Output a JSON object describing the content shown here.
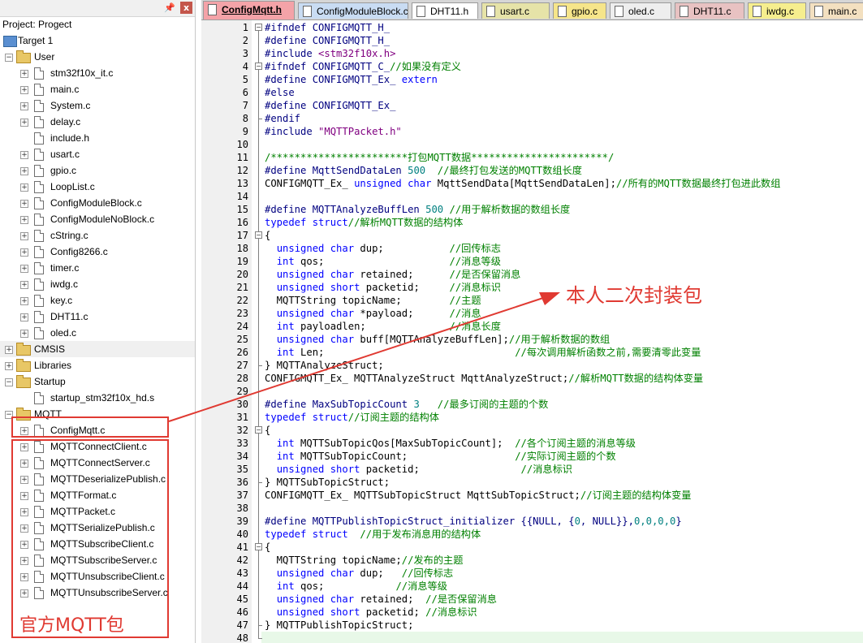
{
  "project_pane": {
    "title": "Project: Progect",
    "pin_icon": "pin-icon",
    "close_label": "x",
    "target": "Target 1",
    "groups": [
      {
        "name": "User",
        "files": [
          "stm32f10x_it.c",
          "main.c",
          "System.c",
          "delay.c",
          "include.h",
          "usart.c",
          "gpio.c",
          "LoopList.c",
          "ConfigModuleBlock.c",
          "ConfigModuleNoBlock.c",
          "cString.c",
          "Config8266.c",
          "timer.c",
          "iwdg.c",
          "key.c",
          "DHT11.c",
          "oled.c"
        ]
      },
      {
        "name": "CMSIS",
        "files": []
      },
      {
        "name": "Libraries",
        "files": []
      },
      {
        "name": "Startup",
        "files": [
          "startup_stm32f10x_hd.s"
        ]
      },
      {
        "name": "MQTT",
        "files": [
          "ConfigMqtt.c",
          "MQTTConnectClient.c",
          "MQTTConnectServer.c",
          "MQTTDeserializePublish.c",
          "MQTTFormat.c",
          "MQTTPacket.c",
          "MQTTSerializePublish.c",
          "MQTTSubscribeClient.c",
          "MQTTSubscribeServer.c",
          "MQTTUnsubscribeClient.c",
          "MQTTUnsubscribeServer.c"
        ]
      }
    ]
  },
  "tabs": [
    {
      "label": "ConfigMqtt.h",
      "active": true,
      "color": "#f4a3a8"
    },
    {
      "label": "ConfigModuleBlock.c",
      "color": "#c9dcf3"
    },
    {
      "label": "DHT11.h",
      "color": "#ffffff"
    },
    {
      "label": "usart.c",
      "color": "#e6e3a8"
    },
    {
      "label": "gpio.c",
      "color": "#f6e58a"
    },
    {
      "label": "oled.c",
      "color": "#eeeeee"
    },
    {
      "label": "DHT11.c",
      "color": "#e8c2c2"
    },
    {
      "label": "iwdg.c",
      "color": "#f6ee8e"
    },
    {
      "label": "main.c",
      "color": "#f3e0c0"
    }
  ],
  "editor": {
    "line_numbers": [
      "1",
      "2",
      "3",
      "4",
      "5",
      "6",
      "7",
      "8",
      "9",
      "10",
      "11",
      "12",
      "13",
      "14",
      "15",
      "16",
      "17",
      "18",
      "19",
      "20",
      "21",
      "22",
      "23",
      "24",
      "25",
      "26",
      "27",
      "28",
      "29",
      "30",
      "31",
      "32",
      "33",
      "34",
      "35",
      "36",
      "37",
      "38",
      "39",
      "40",
      "41",
      "42",
      "43",
      "44",
      "45",
      "46",
      "47",
      "48"
    ],
    "lines": [
      [
        [
          "pp",
          "#ifndef CONFIGMQTT_H_"
        ]
      ],
      [
        [
          "pp",
          "#define CONFIGMQTT_H_"
        ]
      ],
      [
        [
          "pp",
          "#include "
        ],
        [
          "str",
          "<stm32f10x.h>"
        ]
      ],
      [
        [
          "pp",
          "#ifndef CONFIGMQTT_C_"
        ],
        [
          "cm",
          "//如果没有定义"
        ]
      ],
      [
        [
          "pp",
          "#define CONFIGMQTT_Ex_ "
        ],
        [
          "kw",
          "extern"
        ]
      ],
      [
        [
          "pp",
          "#else"
        ]
      ],
      [
        [
          "pp",
          "#define CONFIGMQTT_Ex_"
        ]
      ],
      [
        [
          "pp",
          "#endif"
        ]
      ],
      [
        [
          "pp",
          "#include "
        ],
        [
          "str",
          "\"MQTTPacket.h\""
        ]
      ],
      [],
      [
        [
          "cm",
          "/***********************打包MQTT数据***********************/"
        ]
      ],
      [
        [
          "pp",
          "#define MqttSendDataLen "
        ],
        [
          "num",
          "500"
        ],
        [
          "cm",
          "  //最终打包发送的MQTT数组长度"
        ]
      ],
      [
        [
          "tx",
          "CONFIGMQTT_Ex_ "
        ],
        [
          "kw",
          "unsigned char"
        ],
        [
          "tx",
          " MqttSendData[MqttSendDataLen];"
        ],
        [
          "cm",
          "//所有的MQTT数据最终打包进此数组"
        ]
      ],
      [],
      [
        [
          "pp",
          "#define MQTTAnalyzeBuffLen "
        ],
        [
          "num",
          "500"
        ],
        [
          "cm",
          " //用于解析数据的数组长度"
        ]
      ],
      [
        [
          "kw",
          "typedef struct"
        ],
        [
          "cm",
          "//解析MQTT数据的结构体"
        ]
      ],
      [
        [
          "tx",
          "{"
        ]
      ],
      [
        [
          "tx",
          "  "
        ],
        [
          "kw",
          "unsigned char"
        ],
        [
          "tx",
          " dup;           "
        ],
        [
          "cm",
          "//回传标志"
        ]
      ],
      [
        [
          "tx",
          "  "
        ],
        [
          "kw",
          "int"
        ],
        [
          "tx",
          " qos;                     "
        ],
        [
          "cm",
          "//消息等级"
        ]
      ],
      [
        [
          "tx",
          "  "
        ],
        [
          "kw",
          "unsigned char"
        ],
        [
          "tx",
          " retained;      "
        ],
        [
          "cm",
          "//是否保留消息"
        ]
      ],
      [
        [
          "tx",
          "  "
        ],
        [
          "kw",
          "unsigned short"
        ],
        [
          "tx",
          " packetid;     "
        ],
        [
          "cm",
          "//消息标识"
        ]
      ],
      [
        [
          "tx",
          "  MQTTString topicName;        "
        ],
        [
          "cm",
          "//主题"
        ]
      ],
      [
        [
          "tx",
          "  "
        ],
        [
          "kw",
          "unsigned char"
        ],
        [
          "tx",
          " *payload;      "
        ],
        [
          "cm",
          "//消息"
        ]
      ],
      [
        [
          "tx",
          "  "
        ],
        [
          "kw",
          "int"
        ],
        [
          "tx",
          " payloadlen;              "
        ],
        [
          "cm",
          "//消息长度"
        ]
      ],
      [
        [
          "tx",
          "  "
        ],
        [
          "kw",
          "unsigned char"
        ],
        [
          "tx",
          " buff[MQTTAnalyzeBuffLen];"
        ],
        [
          "cm",
          "//用于解析数据的数组"
        ]
      ],
      [
        [
          "tx",
          "  "
        ],
        [
          "kw",
          "int"
        ],
        [
          "tx",
          " Len;                                "
        ],
        [
          "cm",
          "//每次调用解析函数之前,需要清零此变量"
        ]
      ],
      [
        [
          "tx",
          "} MQTTAnalyzeStruct;"
        ]
      ],
      [
        [
          "tx",
          "CONFIGMQTT_Ex_ MQTTAnalyzeStruct MqttAnalyzeStruct;"
        ],
        [
          "cm",
          "//解析MQTT数据的结构体变量"
        ]
      ],
      [],
      [
        [
          "pp",
          "#define MaxSubTopicCount "
        ],
        [
          "num",
          "3"
        ],
        [
          "cm",
          "   //最多订阅的主题的个数"
        ]
      ],
      [
        [
          "kw",
          "typedef struct"
        ],
        [
          "cm",
          "//订阅主题的结构体"
        ]
      ],
      [
        [
          "tx",
          "{"
        ]
      ],
      [
        [
          "tx",
          "  "
        ],
        [
          "kw",
          "int"
        ],
        [
          "tx",
          " MQTTSubTopicQos[MaxSubTopicCount];  "
        ],
        [
          "cm",
          "//各个订阅主题的消息等级"
        ]
      ],
      [
        [
          "tx",
          "  "
        ],
        [
          "kw",
          "int"
        ],
        [
          "tx",
          " MQTTSubTopicCount;                  "
        ],
        [
          "cm",
          "//实际订阅主题的个数"
        ]
      ],
      [
        [
          "tx",
          "  "
        ],
        [
          "kw",
          "unsigned short"
        ],
        [
          "tx",
          " packetid;                 "
        ],
        [
          "cm",
          "//消息标识"
        ]
      ],
      [
        [
          "tx",
          "} MQTTSubTopicStruct;"
        ]
      ],
      [
        [
          "tx",
          "CONFIGMQTT_Ex_ MQTTSubTopicStruct MqttSubTopicStruct;"
        ],
        [
          "cm",
          "//订阅主题的结构体变量"
        ]
      ],
      [],
      [
        [
          "pp",
          "#define MQTTPublishTopicStruct_initializer {{NULL, {"
        ],
        [
          "num",
          "0"
        ],
        [
          "pp",
          ", NULL}},"
        ],
        [
          "num",
          "0,0,0,0"
        ],
        [
          "pp",
          "}"
        ]
      ],
      [
        [
          "kw",
          "typedef struct"
        ],
        [
          "cm",
          "  //用于发布消息用的结构体"
        ]
      ],
      [
        [
          "tx",
          "{"
        ]
      ],
      [
        [
          "tx",
          "  MQTTString topicName;"
        ],
        [
          "cm",
          "//发布的主题"
        ]
      ],
      [
        [
          "tx",
          "  "
        ],
        [
          "kw",
          "unsigned char"
        ],
        [
          "tx",
          " dup;   "
        ],
        [
          "cm",
          "//回传标志"
        ]
      ],
      [
        [
          "tx",
          "  "
        ],
        [
          "kw",
          "int"
        ],
        [
          "tx",
          " qos;            "
        ],
        [
          "cm",
          "//消息等级"
        ]
      ],
      [
        [
          "tx",
          "  "
        ],
        [
          "kw",
          "unsigned char"
        ],
        [
          "tx",
          " retained;  "
        ],
        [
          "cm",
          "//是否保留消息"
        ]
      ],
      [
        [
          "tx",
          "  "
        ],
        [
          "kw",
          "unsigned short"
        ],
        [
          "tx",
          " packetid; "
        ],
        [
          "cm",
          "//消息标识"
        ]
      ],
      [
        [
          "tx",
          "} MQTTPublishTopicStruct;"
        ]
      ],
      []
    ]
  },
  "annotations": {
    "own_package": "本人二次封装包",
    "official_package": "官方MQTT包"
  },
  "colors": {
    "preprocessor": "#000080",
    "keyword": "#0000ff",
    "comment": "#008000",
    "string": "#800080",
    "number": "#008080",
    "text": "#000000",
    "annotation": "#e03a32"
  }
}
